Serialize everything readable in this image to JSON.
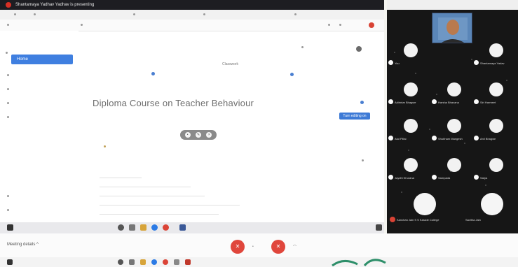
{
  "banner": {
    "text": "Shantamaya Yadhav Yadhav is presenting"
  },
  "screen": {
    "sidebar_selected": "Home",
    "top_center_label": "Classwork",
    "course_title": "Diploma Course on Teacher Behaviour",
    "chip_label": "Turn editing on"
  },
  "participants": [
    {
      "name": "You"
    },
    {
      "name": "Shantamaya Yadav"
    },
    {
      "name": "Adirintar Bhagwe"
    },
    {
      "name": "Harsha Bhavana"
    },
    {
      "name": "Siri Harmeet"
    },
    {
      "name": "Atul Pillai"
    },
    {
      "name": "Shubham Mangesh"
    },
    {
      "name": "Anil Bhagwe"
    },
    {
      "name": "Jaydhi Khurana"
    },
    {
      "name": "Sampada"
    },
    {
      "name": "Satya"
    },
    {
      "name": "Kanchan Jain S S Karade College"
    },
    {
      "name": "Savitha Jain"
    }
  ],
  "meet": {
    "label": "Meeting details",
    "chevron": "^"
  },
  "colors": {
    "accent": "#3f7fe0",
    "end_call": "#e0463c",
    "record": "#d93025"
  }
}
